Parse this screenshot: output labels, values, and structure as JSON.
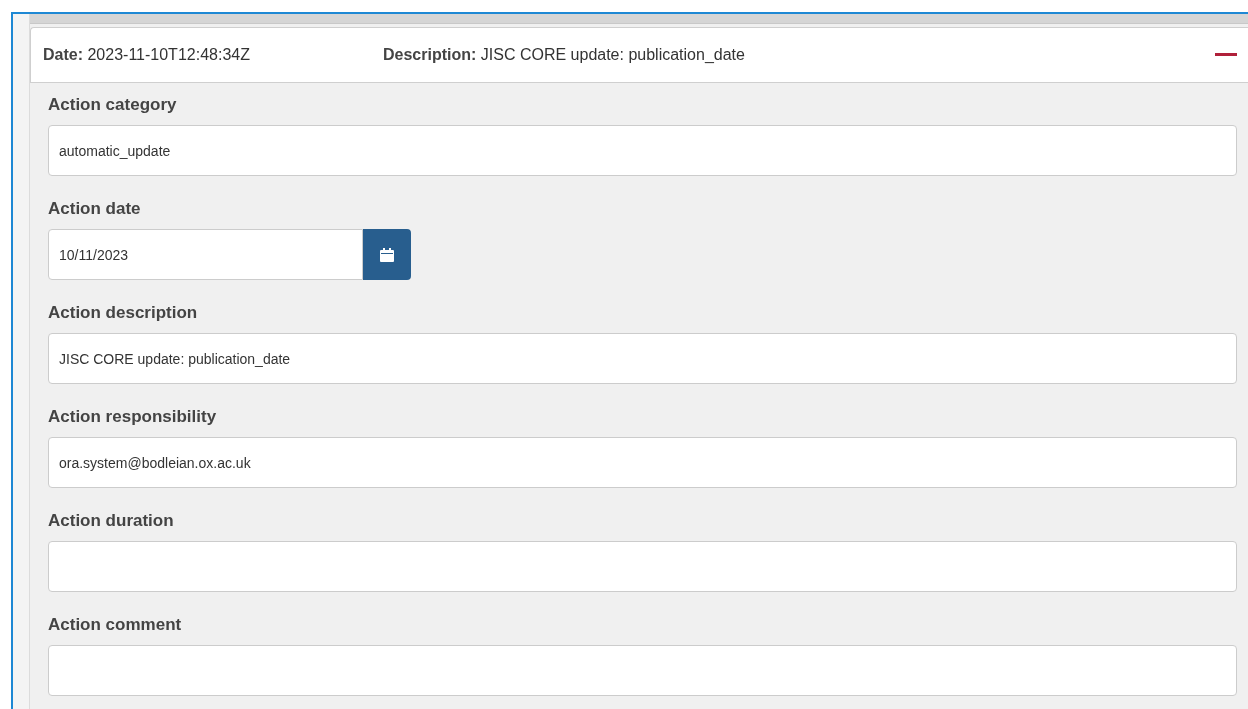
{
  "header": {
    "date": "**Date:** 2023-11-10T12:48:34Z",
    "description": "**Description:** JISC CORE update: publication_date",
    "expanded": true
  },
  "fields": [
    {
      "kind": "text",
      "label": "Action category",
      "value": "automatic_update"
    },
    {
      "kind": "date",
      "label": "Action date",
      "value": "10/11/2023"
    },
    {
      "kind": "text",
      "label": "Action description",
      "value": "JISC CORE update: publication_date"
    },
    {
      "kind": "text",
      "label": "Action responsibility",
      "value": "ora.system@bodleian.ox.ac.uk"
    },
    {
      "kind": "text",
      "label": "Action duration"
    },
    {
      "kind": "text",
      "label": "Action comment"
    }
  ]
}
